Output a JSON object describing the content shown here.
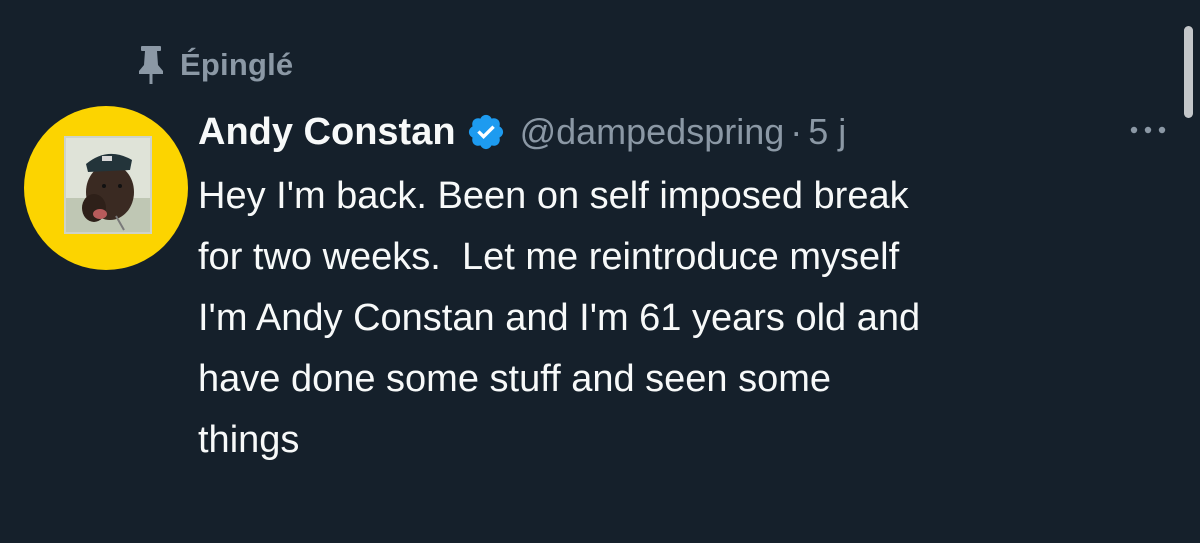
{
  "theme": {
    "background": "#15202b",
    "primary_text": "#f7f9f9",
    "secondary_text": "#8b98a5",
    "verified_badge": "#1d9bf0",
    "avatar_background": "#fcd400"
  },
  "pinned": {
    "icon": "pin-icon",
    "label": "Épinglé"
  },
  "tweet": {
    "author": {
      "display_name": "Andy Constan",
      "verified": true,
      "verified_icon": "verified-badge-icon",
      "handle": "@dampedspring",
      "avatar_icon": "avatar"
    },
    "separator": "·",
    "timestamp": "5 j",
    "more_icon": "more-options-icon",
    "text_lines": [
      "Hey I'm back. Been on self imposed break",
      "for two weeks.  Let me reintroduce myself",
      "I'm Andy Constan and I'm 61 years old and",
      "have done some stuff and seen some",
      "things"
    ]
  }
}
